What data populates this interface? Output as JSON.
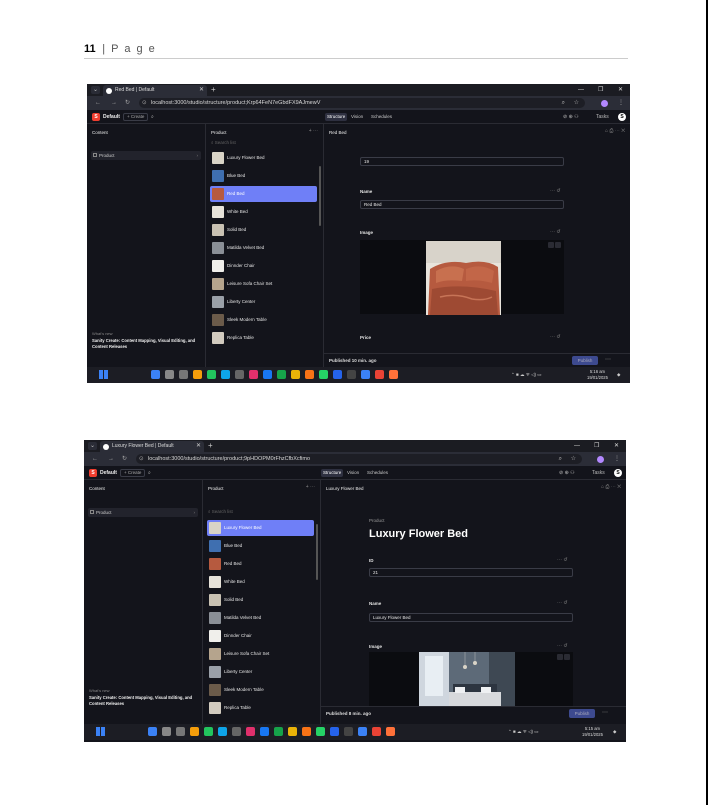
{
  "header": {
    "page_number": "11",
    "page_word": "P a g e"
  },
  "shots": [
    {
      "tab_title": "Red Bed | Default",
      "url": "localhost:3000/studio/structure/product;Krp64FeN7eGbdFX9AJmewV",
      "workspace": "Default",
      "create": "+ Create",
      "nav": [
        "Structure",
        "Vision",
        "Schedules"
      ],
      "tasks": "Tasks",
      "avatar": "S",
      "content_pane_title": "Content",
      "sidebar_item": "Product",
      "whats_new_label": "What's new",
      "whats_new_text": "Sanity Create: Content Mapping, Visual Editing, and Content Releases",
      "list_title": "Product",
      "search_placeholder": "Search list",
      "products": [
        "Luxury Flower Bed",
        "Blue Bed",
        "Red Bed",
        "White Bed",
        "Solid Bed",
        "Matilda Velvet Bed",
        "Dinnder Chair",
        "Leisure Sofa Chair Set",
        "Liberty Center",
        "Sleek Modern Table",
        "Replica Table"
      ],
      "active_index": 2,
      "doc_title": "Red Bed",
      "id_value": "19",
      "name_label": "Name",
      "name_value": "Red Bed",
      "image_label": "Image",
      "price_label": "Price",
      "published": "Published 10 min. ago",
      "publish_btn": "Publish",
      "clock_time": "5:16 am",
      "clock_date": "19/01/2025",
      "colors": {
        "accent": "#6f7ff7",
        "bg": "#13141b",
        "logo": "#f03e2f"
      }
    },
    {
      "tab_title": "Luxury Flower Bed | Default",
      "url": "localhost:3000/studio/structure/product;9pHDOPM0rFhzCfbXcfimo",
      "workspace": "Default",
      "create": "+ Create",
      "nav": [
        "Structure",
        "Vision",
        "Schedules"
      ],
      "tasks": "Tasks",
      "avatar": "S",
      "content_pane_title": "Content",
      "sidebar_item": "Product",
      "whats_new_label": "What's new",
      "whats_new_text": "Sanity Create: Content Mapping, Visual Editing, and Content Releases",
      "list_title": "Product",
      "search_placeholder": "Search list",
      "products": [
        "Luxury Flower Bed",
        "Blue Bed",
        "Red Bed",
        "White Bed",
        "Solid Bed",
        "Matilda Velvet Bed",
        "Dinnder Chair",
        "Leisure Sofa Chair Set",
        "Liberty Center",
        "Sleek Modern Table",
        "Replica Table"
      ],
      "active_index": 0,
      "doc_title": "Luxury Flower Bed",
      "eyebrow": "Product",
      "big_title": "Luxury Flower Bed",
      "id_label": "ID",
      "id_value": "21",
      "name_label": "Name",
      "name_value": "Luxury Flower Bed",
      "image_label": "Image",
      "published": "Published 8 min. ago",
      "publish_btn": "Publish",
      "clock_time": "5:15 am",
      "clock_date": "19/01/2025",
      "colors": {
        "accent": "#6f7ff7",
        "bg": "#13141b",
        "logo": "#f03e2f"
      }
    }
  ]
}
